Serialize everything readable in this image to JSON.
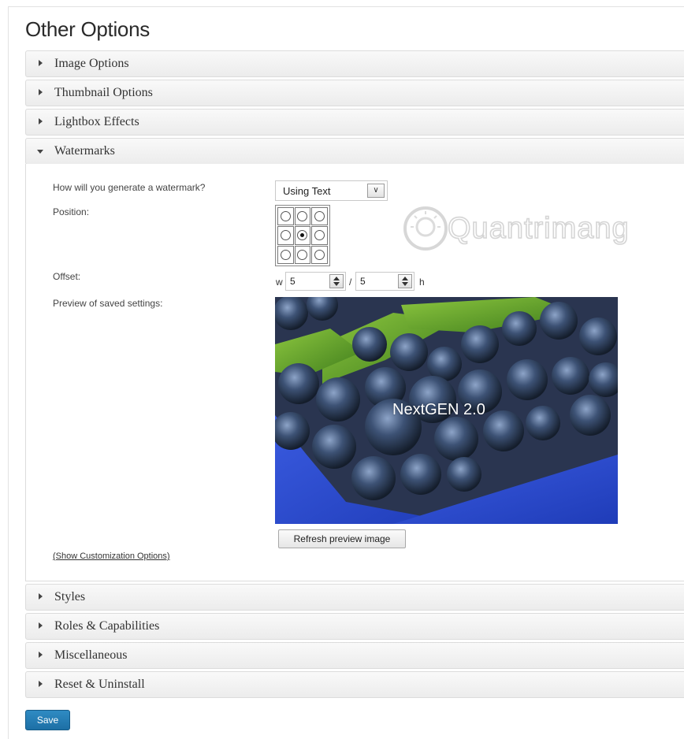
{
  "page": {
    "title": "Other Options"
  },
  "sections_top": [
    {
      "label": "Image Options"
    },
    {
      "label": "Thumbnail Options"
    },
    {
      "label": "Lightbox Effects"
    },
    {
      "label": "Watermarks"
    }
  ],
  "watermarks": {
    "method_label": "How will you generate a watermark?",
    "method_value": "Using Text",
    "position_label": "Position:",
    "position_selected": {
      "row": 2,
      "col": 2
    },
    "offset_label": "Offset:",
    "offset_w_prefix": "w",
    "offset_w": "5",
    "offset_sep": "/",
    "offset_h": "5",
    "offset_h_suffix": "h",
    "preview_label": "Preview of saved settings:",
    "preview_text": "NextGEN 2.0",
    "refresh_label": "Refresh preview image",
    "customize_link": "(Show Customization Options)"
  },
  "sections_bottom": [
    {
      "label": "Styles"
    },
    {
      "label": "Roles & Capabilities"
    },
    {
      "label": "Miscellaneous"
    },
    {
      "label": "Reset & Uninstall"
    }
  ],
  "save_label": "Save",
  "overlay_watermark": "Quantrimang",
  "colors": {
    "save_blue": "#2278b0",
    "section_bg": "#f1f1f1"
  }
}
